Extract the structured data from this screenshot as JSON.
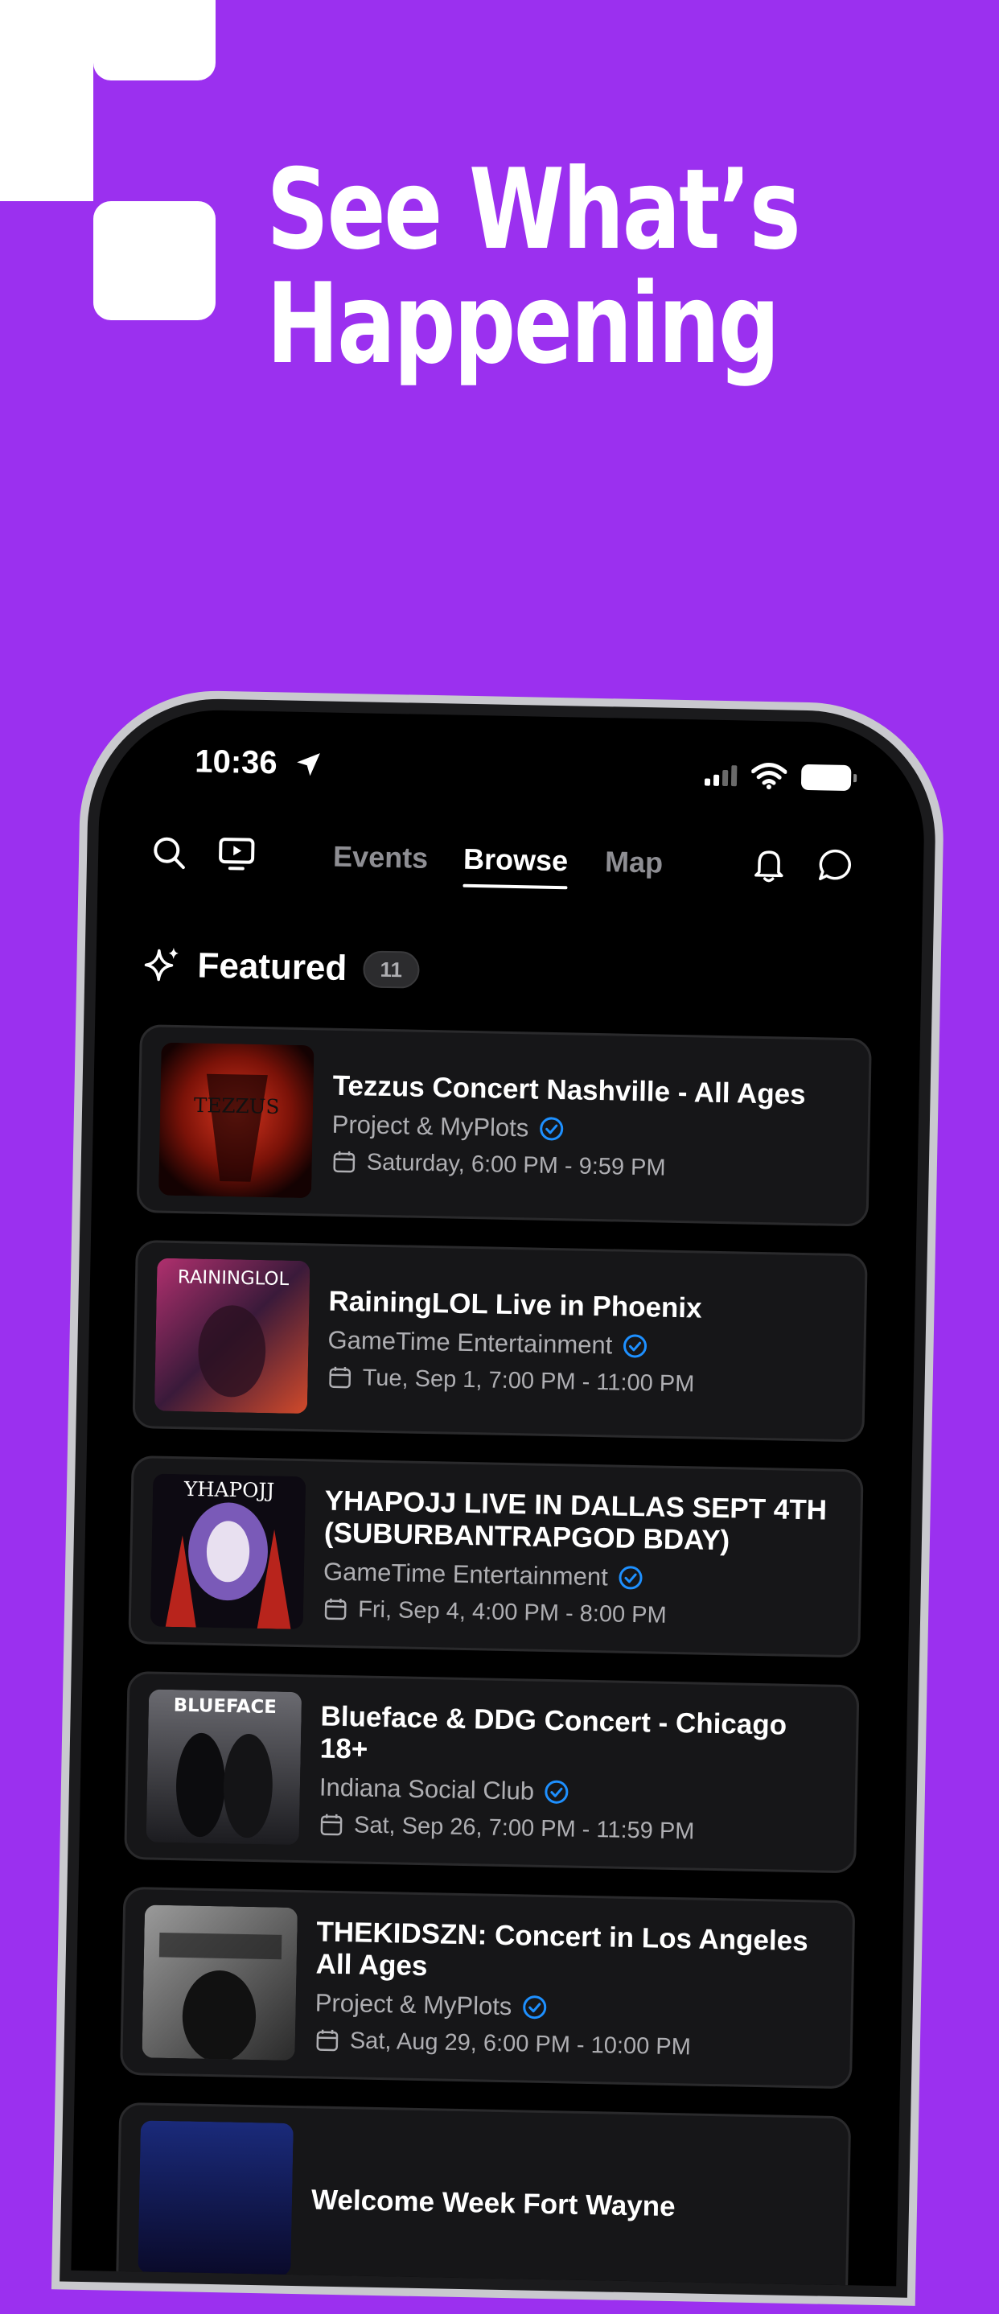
{
  "headline": {
    "line1": "See What’s",
    "line2": "Happening"
  },
  "status_bar": {
    "time": "10:36"
  },
  "nav": {
    "tabs": [
      {
        "label": "Events",
        "active": false
      },
      {
        "label": "Browse",
        "active": true
      },
      {
        "label": "Map",
        "active": false
      }
    ],
    "icons": [
      "search-icon",
      "tv-play-icon",
      "bell-icon",
      "chat-icon"
    ]
  },
  "featured": {
    "title": "Featured",
    "count": "11",
    "icon": "sparkles-icon"
  },
  "events": [
    {
      "title": "Tezzus Concert Nashville - All Ages",
      "organizer": "Project & MyPlots",
      "date": "Saturday, 6:00 PM - 9:59 PM"
    },
    {
      "title": "RainingLOL Live in Phoenix",
      "organizer": "GameTime Entertainment",
      "date": "Tue, Sep 1, 7:00 PM - 11:00 PM"
    },
    {
      "title": "YHAPOJJ LIVE IN DALLAS SEPT 4TH (SUBURBANTRAPGOD BDAY)",
      "organizer": "GameTime Entertainment",
      "date": "Fri, Sep 4, 4:00 PM - 8:00 PM"
    },
    {
      "title": "Blueface & DDG Concert - Chicago 18+",
      "organizer": "Indiana Social Club",
      "date": "Sat, Sep 26, 7:00 PM - 11:59 PM"
    },
    {
      "title": "THEKIDSZN: Concert in Los Angeles All Ages",
      "organizer": "Project & MyPlots",
      "date": "Sat, Aug 29, 6:00 PM - 10:00 PM"
    },
    {
      "title": "Welcome Week Fort Wayne",
      "organizer": "",
      "date": ""
    }
  ],
  "colors": {
    "background": "#9b30ef",
    "verified": "#1e90ff",
    "screen": "#000000"
  }
}
